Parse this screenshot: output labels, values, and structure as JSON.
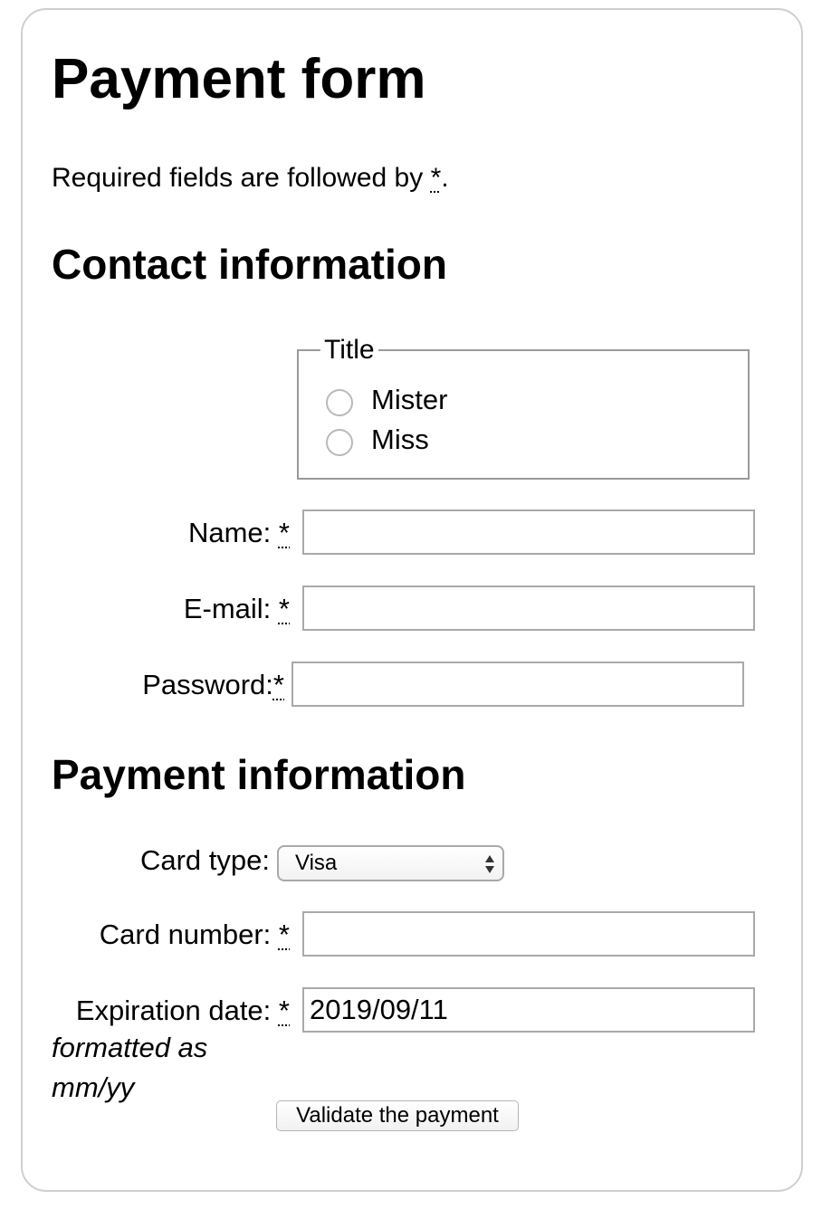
{
  "form": {
    "title": "Payment form",
    "required_note_prefix": "Required fields are followed by ",
    "required_marker": "*",
    "required_note_suffix": "."
  },
  "contact": {
    "heading": "Contact information",
    "title_legend": "Title",
    "title_options": [
      "Mister",
      "Miss"
    ],
    "name_label": "Name:",
    "name_value": "",
    "email_label": "E-mail:",
    "email_value": "",
    "password_label": "Password:",
    "password_value": ""
  },
  "payment": {
    "heading": "Payment information",
    "card_type_label": "Card type:",
    "card_type_value": "Visa",
    "card_number_label": "Card number:",
    "card_number_value": "",
    "expiration_label": "Expiration date:",
    "expiration_value": "2019/09/11",
    "expiration_hint": "formatted as mm/yy",
    "submit_label": "Validate the payment"
  },
  "icons": {
    "select_arrows": "up-down-arrows-icon"
  }
}
